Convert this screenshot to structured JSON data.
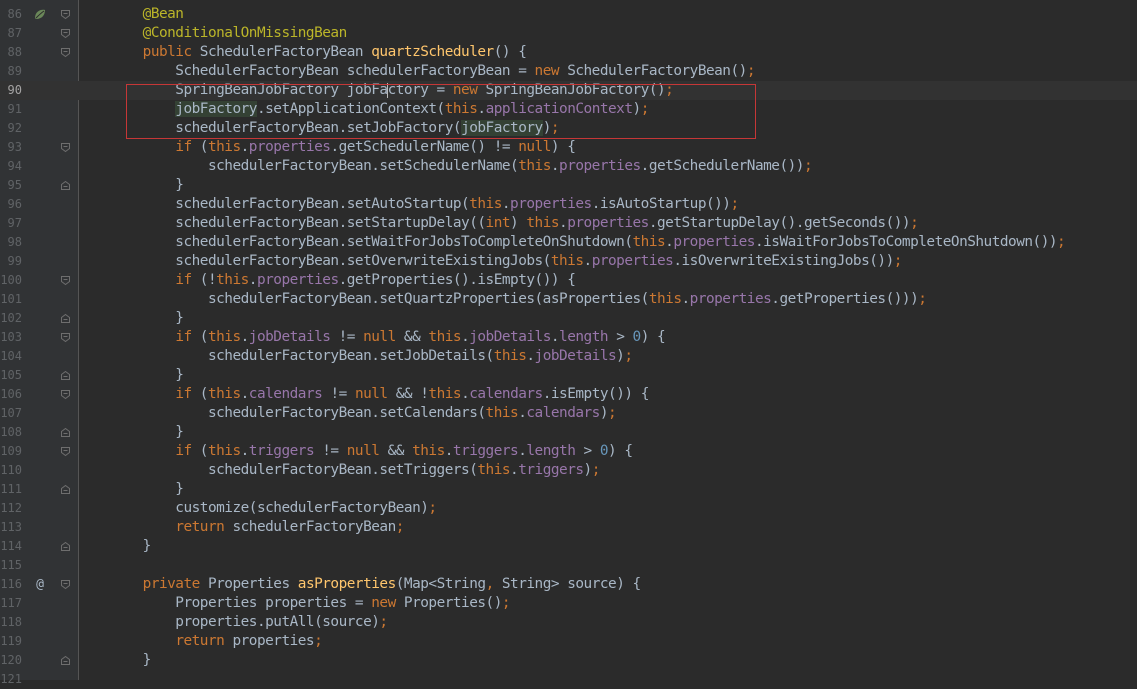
{
  "editor": {
    "language": "Java",
    "current_line": "90",
    "colors": {
      "background": "#2b2b2b",
      "gutter": "#313335",
      "keyword": "#cc7832",
      "annotation": "#bbb529",
      "method_declaration": "#ffc66d",
      "field": "#9876aa",
      "number": "#6897bb",
      "default_text": "#a9b7c6",
      "highlight_box": "#c63737"
    },
    "annotation_box_lines": [
      "90",
      "92"
    ],
    "lines": [
      {
        "num": "86",
        "gutter_icon": "bean-icon",
        "fold": "open",
        "tokens": [
          [
            "    ",
            ""
          ],
          [
            "@Bean",
            "ann"
          ]
        ]
      },
      {
        "num": "87",
        "fold": "open",
        "tokens": [
          [
            "    ",
            ""
          ],
          [
            "@ConditionalOnMissingBean",
            "ann"
          ]
        ]
      },
      {
        "num": "88",
        "fold": "open",
        "tokens": [
          [
            "    ",
            ""
          ],
          [
            "public",
            "kw"
          ],
          [
            " SchedulerFactoryBean ",
            ""
          ],
          [
            "quartzScheduler",
            "fn"
          ],
          [
            "() {",
            ""
          ]
        ]
      },
      {
        "num": "89",
        "tokens": [
          [
            "        SchedulerFactoryBean schedulerFactoryBean = ",
            ""
          ],
          [
            "new",
            "kw"
          ],
          [
            " SchedulerFactoryBean()",
            ""
          ],
          [
            ";",
            "kw"
          ]
        ]
      },
      {
        "num": "90",
        "current": true,
        "tokens": [
          [
            "        SpringBeanJobFactory jobFa",
            ""
          ],
          [
            "|",
            "caret"
          ],
          [
            "ctory = ",
            ""
          ],
          [
            "new",
            "kw"
          ],
          [
            " SpringBeanJobFactory()",
            ""
          ],
          [
            ";",
            "kw"
          ]
        ]
      },
      {
        "num": "91",
        "tokens": [
          [
            "        ",
            ""
          ],
          [
            "jobFactory",
            "hl"
          ],
          [
            ".setApplicationContext(",
            ""
          ],
          [
            "this",
            "kw"
          ],
          [
            ".",
            ""
          ],
          [
            "applicationContext",
            "fld"
          ],
          [
            ")",
            ""
          ],
          [
            ";",
            "kw"
          ]
        ]
      },
      {
        "num": "92",
        "tokens": [
          [
            "        schedulerFactoryBean.setJobFactory(",
            ""
          ],
          [
            "jobFactory",
            "hl"
          ],
          [
            ")",
            ""
          ],
          [
            ";",
            "kw"
          ]
        ]
      },
      {
        "num": "93",
        "fold": "open",
        "tokens": [
          [
            "        ",
            ""
          ],
          [
            "if",
            "kw"
          ],
          [
            " (",
            ""
          ],
          [
            "this",
            "kw"
          ],
          [
            ".",
            ""
          ],
          [
            "properties",
            "fld"
          ],
          [
            ".getSchedulerName() != ",
            ""
          ],
          [
            "null",
            "kw"
          ],
          [
            ") {",
            ""
          ]
        ]
      },
      {
        "num": "94",
        "tokens": [
          [
            "            schedulerFactoryBean.setSchedulerName(",
            ""
          ],
          [
            "this",
            "kw"
          ],
          [
            ".",
            ""
          ],
          [
            "properties",
            "fld"
          ],
          [
            ".getSchedulerName())",
            ""
          ],
          [
            ";",
            "kw"
          ]
        ]
      },
      {
        "num": "95",
        "fold": "close",
        "tokens": [
          [
            "        }",
            ""
          ]
        ]
      },
      {
        "num": "96",
        "tokens": [
          [
            "        schedulerFactoryBean.setAutoStartup(",
            ""
          ],
          [
            "this",
            "kw"
          ],
          [
            ".",
            ""
          ],
          [
            "properties",
            "fld"
          ],
          [
            ".isAutoStartup())",
            ""
          ],
          [
            ";",
            "kw"
          ]
        ]
      },
      {
        "num": "97",
        "tokens": [
          [
            "        schedulerFactoryBean.setStartupDelay((",
            ""
          ],
          [
            "int",
            "kw"
          ],
          [
            ") ",
            ""
          ],
          [
            "this",
            "kw"
          ],
          [
            ".",
            ""
          ],
          [
            "properties",
            "fld"
          ],
          [
            ".getStartupDelay().getSeconds())",
            ""
          ],
          [
            ";",
            "kw"
          ]
        ]
      },
      {
        "num": "98",
        "tokens": [
          [
            "        schedulerFactoryBean.setWaitForJobsToCompleteOnShutdown(",
            ""
          ],
          [
            "this",
            "kw"
          ],
          [
            ".",
            ""
          ],
          [
            "properties",
            "fld"
          ],
          [
            ".isWaitForJobsToCompleteOnShutdown())",
            ""
          ],
          [
            ";",
            "kw"
          ]
        ]
      },
      {
        "num": "99",
        "tokens": [
          [
            "        schedulerFactoryBean.setOverwriteExistingJobs(",
            ""
          ],
          [
            "this",
            "kw"
          ],
          [
            ".",
            ""
          ],
          [
            "properties",
            "fld"
          ],
          [
            ".isOverwriteExistingJobs())",
            ""
          ],
          [
            ";",
            "kw"
          ]
        ]
      },
      {
        "num": "100",
        "fold": "open",
        "tokens": [
          [
            "        ",
            ""
          ],
          [
            "if",
            "kw"
          ],
          [
            " (!",
            ""
          ],
          [
            "this",
            "kw"
          ],
          [
            ".",
            ""
          ],
          [
            "properties",
            "fld"
          ],
          [
            ".getProperties().isEmpty()) {",
            ""
          ]
        ]
      },
      {
        "num": "101",
        "tokens": [
          [
            "            schedulerFactoryBean.setQuartzProperties(asProperties(",
            ""
          ],
          [
            "this",
            "kw"
          ],
          [
            ".",
            ""
          ],
          [
            "properties",
            "fld"
          ],
          [
            ".getProperties()))",
            ""
          ],
          [
            ";",
            "kw"
          ]
        ]
      },
      {
        "num": "102",
        "fold": "close",
        "tokens": [
          [
            "        }",
            ""
          ]
        ]
      },
      {
        "num": "103",
        "fold": "open",
        "tokens": [
          [
            "        ",
            ""
          ],
          [
            "if",
            "kw"
          ],
          [
            " (",
            ""
          ],
          [
            "this",
            "kw"
          ],
          [
            ".",
            ""
          ],
          [
            "jobDetails",
            "fld"
          ],
          [
            " != ",
            ""
          ],
          [
            "null",
            "kw"
          ],
          [
            " && ",
            ""
          ],
          [
            "this",
            "kw"
          ],
          [
            ".",
            ""
          ],
          [
            "jobDetails",
            "fld"
          ],
          [
            ".",
            ""
          ],
          [
            "length",
            "fld"
          ],
          [
            " > ",
            ""
          ],
          [
            "0",
            "num"
          ],
          [
            ") {",
            ""
          ]
        ]
      },
      {
        "num": "104",
        "tokens": [
          [
            "            schedulerFactoryBean.setJobDetails(",
            ""
          ],
          [
            "this",
            "kw"
          ],
          [
            ".",
            ""
          ],
          [
            "jobDetails",
            "fld"
          ],
          [
            ")",
            ""
          ],
          [
            ";",
            "kw"
          ]
        ]
      },
      {
        "num": "105",
        "fold": "close",
        "tokens": [
          [
            "        }",
            ""
          ]
        ]
      },
      {
        "num": "106",
        "fold": "open",
        "tokens": [
          [
            "        ",
            ""
          ],
          [
            "if",
            "kw"
          ],
          [
            " (",
            ""
          ],
          [
            "this",
            "kw"
          ],
          [
            ".",
            ""
          ],
          [
            "calendars",
            "fld"
          ],
          [
            " != ",
            ""
          ],
          [
            "null",
            "kw"
          ],
          [
            " && !",
            ""
          ],
          [
            "this",
            "kw"
          ],
          [
            ".",
            ""
          ],
          [
            "calendars",
            "fld"
          ],
          [
            ".isEmpty()) {",
            ""
          ]
        ]
      },
      {
        "num": "107",
        "tokens": [
          [
            "            schedulerFactoryBean.setCalendars(",
            ""
          ],
          [
            "this",
            "kw"
          ],
          [
            ".",
            ""
          ],
          [
            "calendars",
            "fld"
          ],
          [
            ")",
            ""
          ],
          [
            ";",
            "kw"
          ]
        ]
      },
      {
        "num": "108",
        "fold": "close",
        "tokens": [
          [
            "        }",
            ""
          ]
        ]
      },
      {
        "num": "109",
        "fold": "open",
        "tokens": [
          [
            "        ",
            ""
          ],
          [
            "if",
            "kw"
          ],
          [
            " (",
            ""
          ],
          [
            "this",
            "kw"
          ],
          [
            ".",
            ""
          ],
          [
            "triggers",
            "fld"
          ],
          [
            " != ",
            ""
          ],
          [
            "null",
            "kw"
          ],
          [
            " && ",
            ""
          ],
          [
            "this",
            "kw"
          ],
          [
            ".",
            ""
          ],
          [
            "triggers",
            "fld"
          ],
          [
            ".",
            ""
          ],
          [
            "length",
            "fld"
          ],
          [
            " > ",
            ""
          ],
          [
            "0",
            "num"
          ],
          [
            ") {",
            ""
          ]
        ]
      },
      {
        "num": "110",
        "tokens": [
          [
            "            schedulerFactoryBean.setTriggers(",
            ""
          ],
          [
            "this",
            "kw"
          ],
          [
            ".",
            ""
          ],
          [
            "triggers",
            "fld"
          ],
          [
            ")",
            ""
          ],
          [
            ";",
            "kw"
          ]
        ]
      },
      {
        "num": "111",
        "fold": "close",
        "tokens": [
          [
            "        }",
            ""
          ]
        ]
      },
      {
        "num": "112",
        "tokens": [
          [
            "        customize(schedulerFactoryBean)",
            ""
          ],
          [
            ";",
            "kw"
          ]
        ]
      },
      {
        "num": "113",
        "tokens": [
          [
            "        ",
            ""
          ],
          [
            "return",
            "kw"
          ],
          [
            " schedulerFactoryBean",
            ""
          ],
          [
            ";",
            "kw"
          ]
        ]
      },
      {
        "num": "114",
        "fold": "close",
        "tokens": [
          [
            "    }",
            ""
          ]
        ]
      },
      {
        "num": "115",
        "tokens": []
      },
      {
        "num": "116",
        "gutter_icon": "at-icon",
        "fold": "open",
        "tokens": [
          [
            "    ",
            ""
          ],
          [
            "private",
            "kw"
          ],
          [
            " Properties ",
            ""
          ],
          [
            "asProperties",
            "fn"
          ],
          [
            "(Map<String",
            ""
          ],
          [
            ",",
            "kw"
          ],
          [
            " String> source) {",
            ""
          ]
        ]
      },
      {
        "num": "117",
        "tokens": [
          [
            "        Properties properties = ",
            ""
          ],
          [
            "new",
            "kw"
          ],
          [
            " Properties()",
            ""
          ],
          [
            ";",
            "kw"
          ]
        ]
      },
      {
        "num": "118",
        "tokens": [
          [
            "        properties.putAll(source)",
            ""
          ],
          [
            ";",
            "kw"
          ]
        ]
      },
      {
        "num": "119",
        "tokens": [
          [
            "        ",
            ""
          ],
          [
            "return",
            "kw"
          ],
          [
            " properties",
            ""
          ],
          [
            ";",
            "kw"
          ]
        ]
      },
      {
        "num": "120",
        "fold": "close",
        "tokens": [
          [
            "    }",
            ""
          ]
        ]
      },
      {
        "num": "121",
        "tokens": []
      }
    ]
  }
}
